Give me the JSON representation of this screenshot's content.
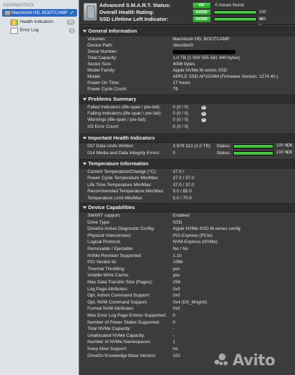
{
  "sidebar": {
    "heading": "DIAGNOSTICS",
    "selected": {
      "label": "Macintosh HD, BOOTCAMP",
      "status_icon": "✔"
    },
    "items": [
      {
        "label": "Health Indicators",
        "badge": "15"
      },
      {
        "label": "Error Log",
        "badge": "0"
      }
    ]
  },
  "header": {
    "rows": [
      {
        "label": "Advanced S.M.A.R.T. Status:",
        "pill": "OK",
        "extra": "0 issues found"
      },
      {
        "label": "Overall Health Rating:",
        "pill": "GOOD",
        "percent": "100 %",
        "level": 1.0
      },
      {
        "label": "SSD Lifetime Left Indicator:",
        "pill": "GOOD",
        "percent": "100 %",
        "level": 1.0
      }
    ]
  },
  "sections": {
    "general": {
      "title": "General Information",
      "rows": [
        {
          "k": "Volumes:",
          "v": "Macintosh HD, BOOTCAMP"
        },
        {
          "k": "Device Path:",
          "v": "/dev/disk0"
        },
        {
          "k": "Serial Number:",
          "v": ""
        },
        {
          "k": "Total Capacity:",
          "v": "1.0 TB (1 000 555 581 440 bytes)"
        },
        {
          "k": "Sector Size:",
          "v": "4096 bytes"
        },
        {
          "k": "Model Family:",
          "v": "Apple NVMe M-series SSD"
        },
        {
          "k": "Model:",
          "v": "APPLE SSD AP1024M  (Firmware Version: 1274.40.)"
        },
        {
          "k": "Power On Time:",
          "v": "17 hours"
        },
        {
          "k": "Power Cycle Count:",
          "v": "79"
        }
      ]
    },
    "problems": {
      "title": "Problems Summary",
      "rows": [
        {
          "k": "Failed Indicators (life-span / pre-fail):",
          "v": "0 (0 / 0)"
        },
        {
          "k": "Failing Indicators (life-span / pre-fail):",
          "v": "0 (0 / 0)"
        },
        {
          "k": "Warnings (life-span / pre-fail):",
          "v": "0 (0 / 0)"
        },
        {
          "k": "I/O Error Count:",
          "v": "0 (0 / 0)"
        }
      ]
    },
    "important": {
      "title": "Important Health Indicators",
      "rows": [
        {
          "k": "007  Data Units Written:",
          "v": "3 979 313 (2.0 TB)",
          "status": "Status:",
          "percent": "100 %",
          "ok": "OK",
          "level": 1.0
        },
        {
          "k": "014  Media and Data Integrity Errors:",
          "v": "0",
          "status": "Status:",
          "percent": "100 %",
          "ok": "OK",
          "level": 1.0
        }
      ]
    },
    "temperature": {
      "title": "Temperature Information",
      "rows": [
        {
          "k": "Current Temperature/Change (°C):",
          "v": "37.0 /"
        },
        {
          "k": "Power Cycle Temperature Min/Max:",
          "v": "37.0 / 37.0"
        },
        {
          "k": "Life Time Temperature Min/Max:",
          "v": "37.0 / 37.0"
        },
        {
          "k": "Recommended Temperature Min/Max:",
          "v": "5.0    / 65.0"
        },
        {
          "k": "Temperature Limit Min/Max:",
          "v": "5.0    / 70.0"
        }
      ]
    },
    "capabilities": {
      "title": "Device Capabilities",
      "rows": [
        {
          "k": "SMART support:",
          "v": "Enabled"
        },
        {
          "k": "Drive Type:",
          "v": "SSD"
        },
        {
          "k": "DriveDx Active Diagnostic Config:",
          "v": "Apple NVMe SSD M-series config"
        },
        {
          "k": "Physical Interconnect:",
          "v": "PCI-Express (PCIe)"
        },
        {
          "k": "Logical Protocol:",
          "v": "NVM-Express (NVMe)"
        },
        {
          "k": "Removable / Ejectable:",
          "v": "No / No"
        },
        {
          "k": "NVMe Revision Supported:",
          "v": "1.10"
        },
        {
          "k": "PCI Vendor Id:",
          "v": "106b"
        },
        {
          "k": "Thermal Throttling:",
          "v": "yes"
        },
        {
          "k": "Volatile Write Cache:",
          "v": "yes"
        },
        {
          "k": "Max Data Transfer Size (Pages):",
          "v": "256"
        },
        {
          "k": "Log Page Attributes:",
          "v": "0x0"
        },
        {
          "k": "Opt. Admin Command Support:",
          "v": "0x0"
        },
        {
          "k": "Opt. NVM Command Support:",
          "v": "0x4 (DS_Mngmt)"
        },
        {
          "k": "Format NVM Attributes:",
          "v": "0x0"
        },
        {
          "k": "Max Error Log Page Entries Supported:",
          "v": "0"
        },
        {
          "k": "Number of Power States Supported:",
          "v": "0"
        },
        {
          "k": "Total NVMe Capacity:",
          "v": "-"
        },
        {
          "k": "Unallocated NVMe Capacity:",
          "v": "-"
        },
        {
          "k": "Number of NVMe Namespaces:",
          "v": "1"
        },
        {
          "k": "Keep Alive Support:",
          "v": "no"
        },
        {
          "k": "DriveDx Knowledge Base Version:",
          "v": "101"
        }
      ]
    }
  },
  "watermark": {
    "text": "Avito"
  }
}
